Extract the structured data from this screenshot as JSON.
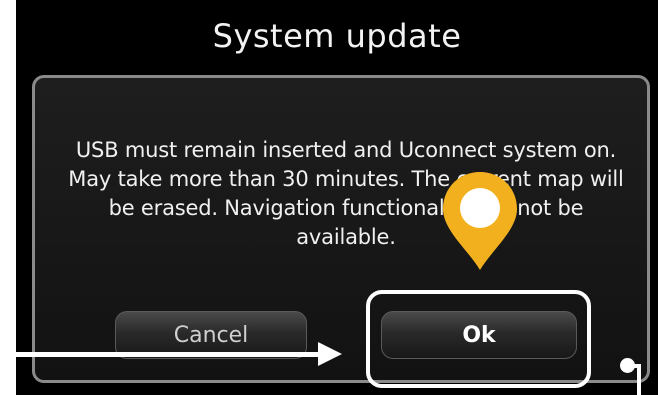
{
  "dialog": {
    "title": "System update",
    "message": "USB must remain inserted and Uconnect system on. May take more than 30 minutes. The current map will be erased. Navigation functionality will not be available.",
    "cancel_label": "Cancel",
    "ok_label": "Ok"
  },
  "overlay": {
    "accent_color": "#f2b01e",
    "pin_icon": "location-pin-icon",
    "arrow_icon": "arrow-right-icon"
  }
}
